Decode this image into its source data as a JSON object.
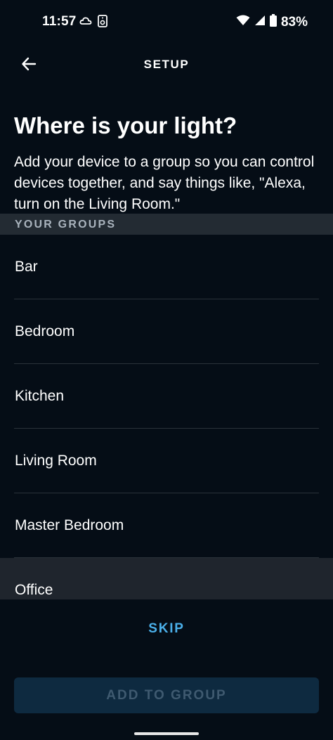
{
  "status": {
    "time": "11:57",
    "battery": "83%",
    "icons_left": [
      "cloud-icon",
      "speaker-icon"
    ],
    "icons_right": [
      "wifi-icon",
      "signal-icon",
      "battery-icon"
    ]
  },
  "header": {
    "title": "SETUP",
    "back_icon": "arrow-left-icon"
  },
  "main": {
    "heading": "Where is your light?",
    "description": "Add your device to a group so you can control devices together, and say things like, \"Alexa, turn on the Living Room.\"",
    "section_label": "YOUR GROUPS",
    "groups": [
      {
        "label": "Bar"
      },
      {
        "label": "Bedroom"
      },
      {
        "label": "Kitchen"
      },
      {
        "label": "Living Room"
      },
      {
        "label": "Master Bedroom"
      },
      {
        "label": "Office"
      }
    ]
  },
  "actions": {
    "skip_label": "SKIP",
    "add_label": "ADD TO GROUP"
  },
  "colors": {
    "background": "#050d16",
    "accent": "#4bb0ea",
    "disabled_button": "#0e2a40"
  }
}
